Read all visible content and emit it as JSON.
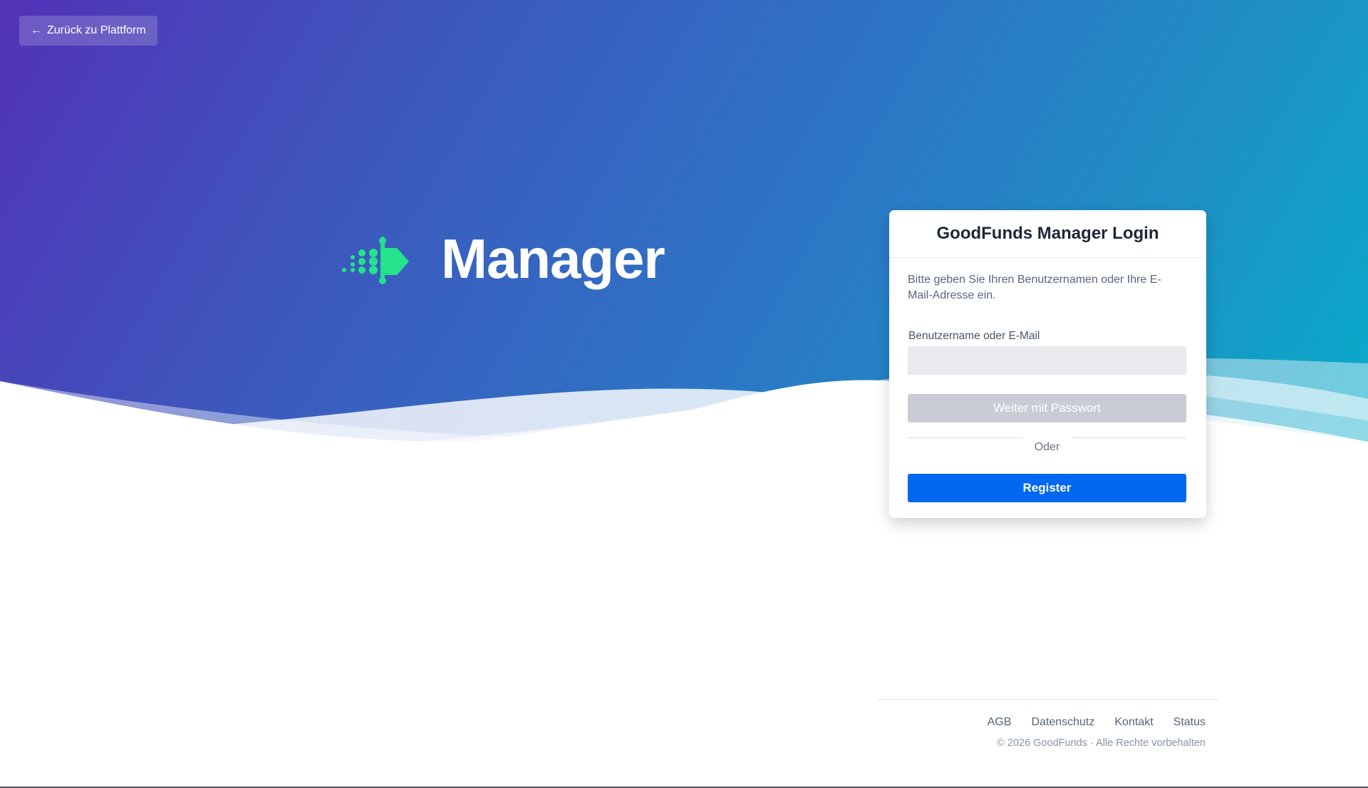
{
  "navigation": {
    "back_label": "Zurück zu Plattform",
    "back_icon": "arrow-left-icon"
  },
  "brand": {
    "logo_icon": "goodfunds-arrow-logo-icon",
    "wordmark": "Manager",
    "logo_color": "#24e38b"
  },
  "login": {
    "title": "GoodFunds Manager Login",
    "instruction": "Bitte geben Sie Ihren Benutzernamen oder Ihre E-Mail-Adresse ein.",
    "username_label": "Benutzername oder E-Mail",
    "username_value": "",
    "password_button_label": "Weiter mit Passwort",
    "password_button_state": "disabled",
    "divider_label": "Oder",
    "register_label": "Register",
    "register_color": "#0068f0"
  },
  "footer": {
    "links": [
      {
        "label": "AGB"
      },
      {
        "label": "Datenschutz"
      },
      {
        "label": "Kontakt"
      },
      {
        "label": "Status"
      }
    ],
    "copyright": "© 2026 GoodFunds · Alle Rechte vorbehalten"
  },
  "colors": {
    "hero_start": "#5232b7",
    "hero_end": "#06aecb",
    "card_background": "#ffffff",
    "text_primary": "#1d2735",
    "text_secondary": "#586579"
  }
}
